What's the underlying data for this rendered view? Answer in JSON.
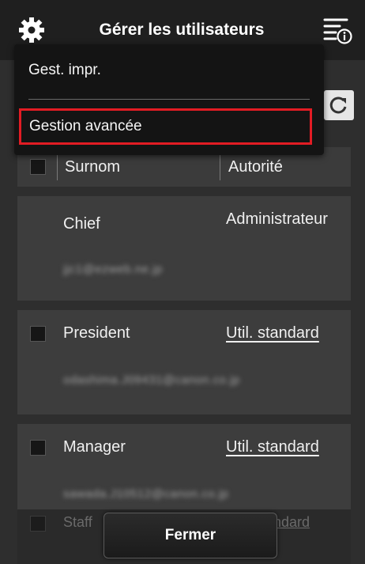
{
  "header": {
    "title": "Gérer les utilisateurs",
    "settings_icon": "gear-icon",
    "menu_icon": "menu-info-icon"
  },
  "toolbar": {
    "refresh_icon": "refresh-icon"
  },
  "dropdown": {
    "items": [
      {
        "label": "Gest. impr."
      },
      {
        "label": "Gestion avancée",
        "highlighted": true
      }
    ],
    "highlight_color": "#e21c24"
  },
  "table": {
    "columns": [
      "Surnom",
      "Autorité"
    ],
    "rows": [
      {
        "name": "Chief",
        "role": "Administrateur",
        "role_is_link": false,
        "has_checkbox": false,
        "email": "jjc1@ezweb.ne.jp"
      },
      {
        "name": "President",
        "role": "Util. standard",
        "role_is_link": true,
        "has_checkbox": true,
        "email": "odashima.J09431@canon.co.jp"
      },
      {
        "name": "Manager",
        "role": "Util. standard",
        "role_is_link": true,
        "has_checkbox": true,
        "email": "sawada.J10512@canon.co.jp"
      },
      {
        "name": "Staff",
        "role": "Util. standard",
        "role_is_link": true,
        "has_checkbox": true
      }
    ]
  },
  "footer": {
    "close_label": "Fermer"
  }
}
